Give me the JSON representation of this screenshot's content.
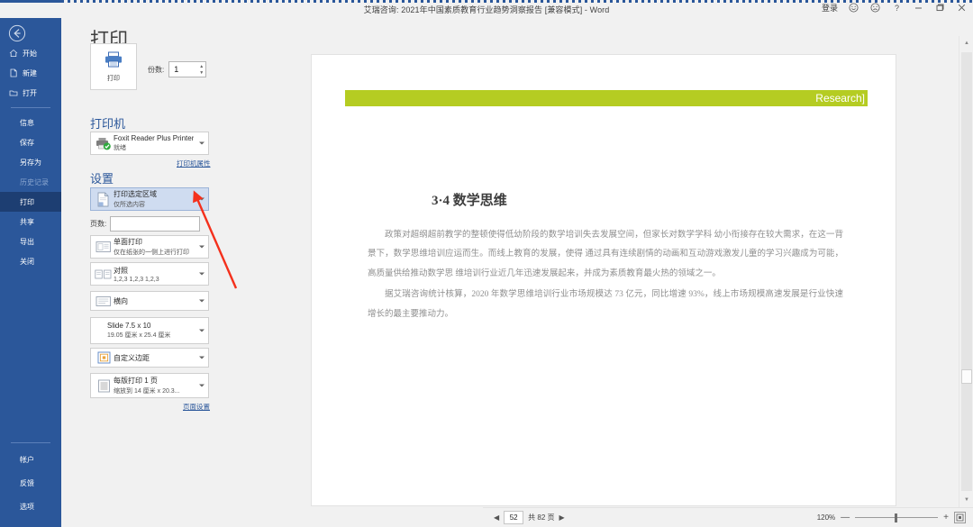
{
  "window": {
    "title": "艾瑞咨询: 2021年中国素质教育行业趋势洞察报告 [兼容模式]  -  Word",
    "signin_label": "登录",
    "help_label": "?",
    "minimize_label": "—",
    "restore_label": "❐",
    "close_label": "✕"
  },
  "backnav": {
    "back_label": "←",
    "top_items": [
      {
        "label": "开始",
        "icon": "home-icon"
      },
      {
        "label": "新建",
        "icon": "new-document-icon"
      },
      {
        "label": "打开",
        "icon": "open-folder-icon"
      }
    ],
    "items": [
      {
        "label": "信息",
        "state": "normal"
      },
      {
        "label": "保存",
        "state": "normal"
      },
      {
        "label": "另存为",
        "state": "normal"
      },
      {
        "label": "历史记录",
        "state": "disabled"
      },
      {
        "label": "打印",
        "state": "selected"
      },
      {
        "label": "共享",
        "state": "normal"
      },
      {
        "label": "导出",
        "state": "normal"
      },
      {
        "label": "关闭",
        "state": "normal"
      }
    ],
    "bottom_items": [
      {
        "label": "帐户"
      },
      {
        "label": "反馈"
      },
      {
        "label": "选项"
      }
    ]
  },
  "print": {
    "pane_title": "打印",
    "print_button_label": "打印",
    "copies_label": "份数:",
    "copies_value": "1",
    "printer_section": "打印机",
    "printer_name": "Foxit Reader Plus Printer",
    "printer_status": "就绪",
    "printer_properties_link": "打印机属性",
    "settings_section": "设置",
    "pages_label": "页数:",
    "pages_value": "",
    "page_setup_link": "页面设置",
    "options": [
      {
        "id": "print-range",
        "title": "打印选定区域",
        "subtitle": "仅所选内容",
        "icon": "print-selection-icon",
        "selected": true
      },
      {
        "id": "sided",
        "title": "单面打印",
        "subtitle": "仅在纸张的一侧上进行打印",
        "icon": "one-sided-icon",
        "selected": false
      },
      {
        "id": "collate",
        "title": "对照",
        "subtitle": "1,2,3   1,2,3   1,2,3",
        "icon": "collate-icon",
        "selected": false
      },
      {
        "id": "orientation",
        "title": "横向",
        "subtitle": "",
        "icon": "landscape-icon",
        "selected": false
      },
      {
        "id": "paper-size",
        "title": "Slide 7.5 x 10",
        "subtitle": "19.05 厘米 x 25.4 厘米",
        "icon": "",
        "selected": false
      },
      {
        "id": "margins",
        "title": "自定义边距",
        "subtitle": "",
        "icon": "margins-icon",
        "selected": false
      },
      {
        "id": "pages-per-sheet",
        "title": "每版打印 1 页",
        "subtitle": "缩放到 14 厘米 x 20.3...",
        "icon": "pages-per-sheet-icon",
        "selected": false
      }
    ]
  },
  "document": {
    "banner_text": "Research]",
    "banner_color": "#b5cc22",
    "heading": "3·4 数学思维",
    "paragraphs": [
      "政策对超纲超前教学的整顿使得低幼阶段的数学培训失去发展空间，但家长对数学学科 幼小衔接存在较大需求，在这一背景下，数学思维培训应运而生。而线上教育的发展，使得 通过具有连续剧情的动画和互动游戏激发儿童的学习兴趣成为可能，高质量供给推动数学思 维培训行业近几年迅速发展起来，并成为素质教育最火热的领域之一。",
      "据艾瑞咨询统计核算，2020 年数学思维培训行业市场规模达 73 亿元，同比增速 93%，线上市场规模高速发展是行业快速增长的最主要推动力。"
    ]
  },
  "status": {
    "prev_label": "◀",
    "next_label": "▶",
    "current_page": "52",
    "total_pages": "共 82 页",
    "zoom_label": "120%",
    "zoom_minus": "—",
    "zoom_plus": "+"
  },
  "annotation": {
    "color": "#f4301c",
    "type": "arrow"
  }
}
